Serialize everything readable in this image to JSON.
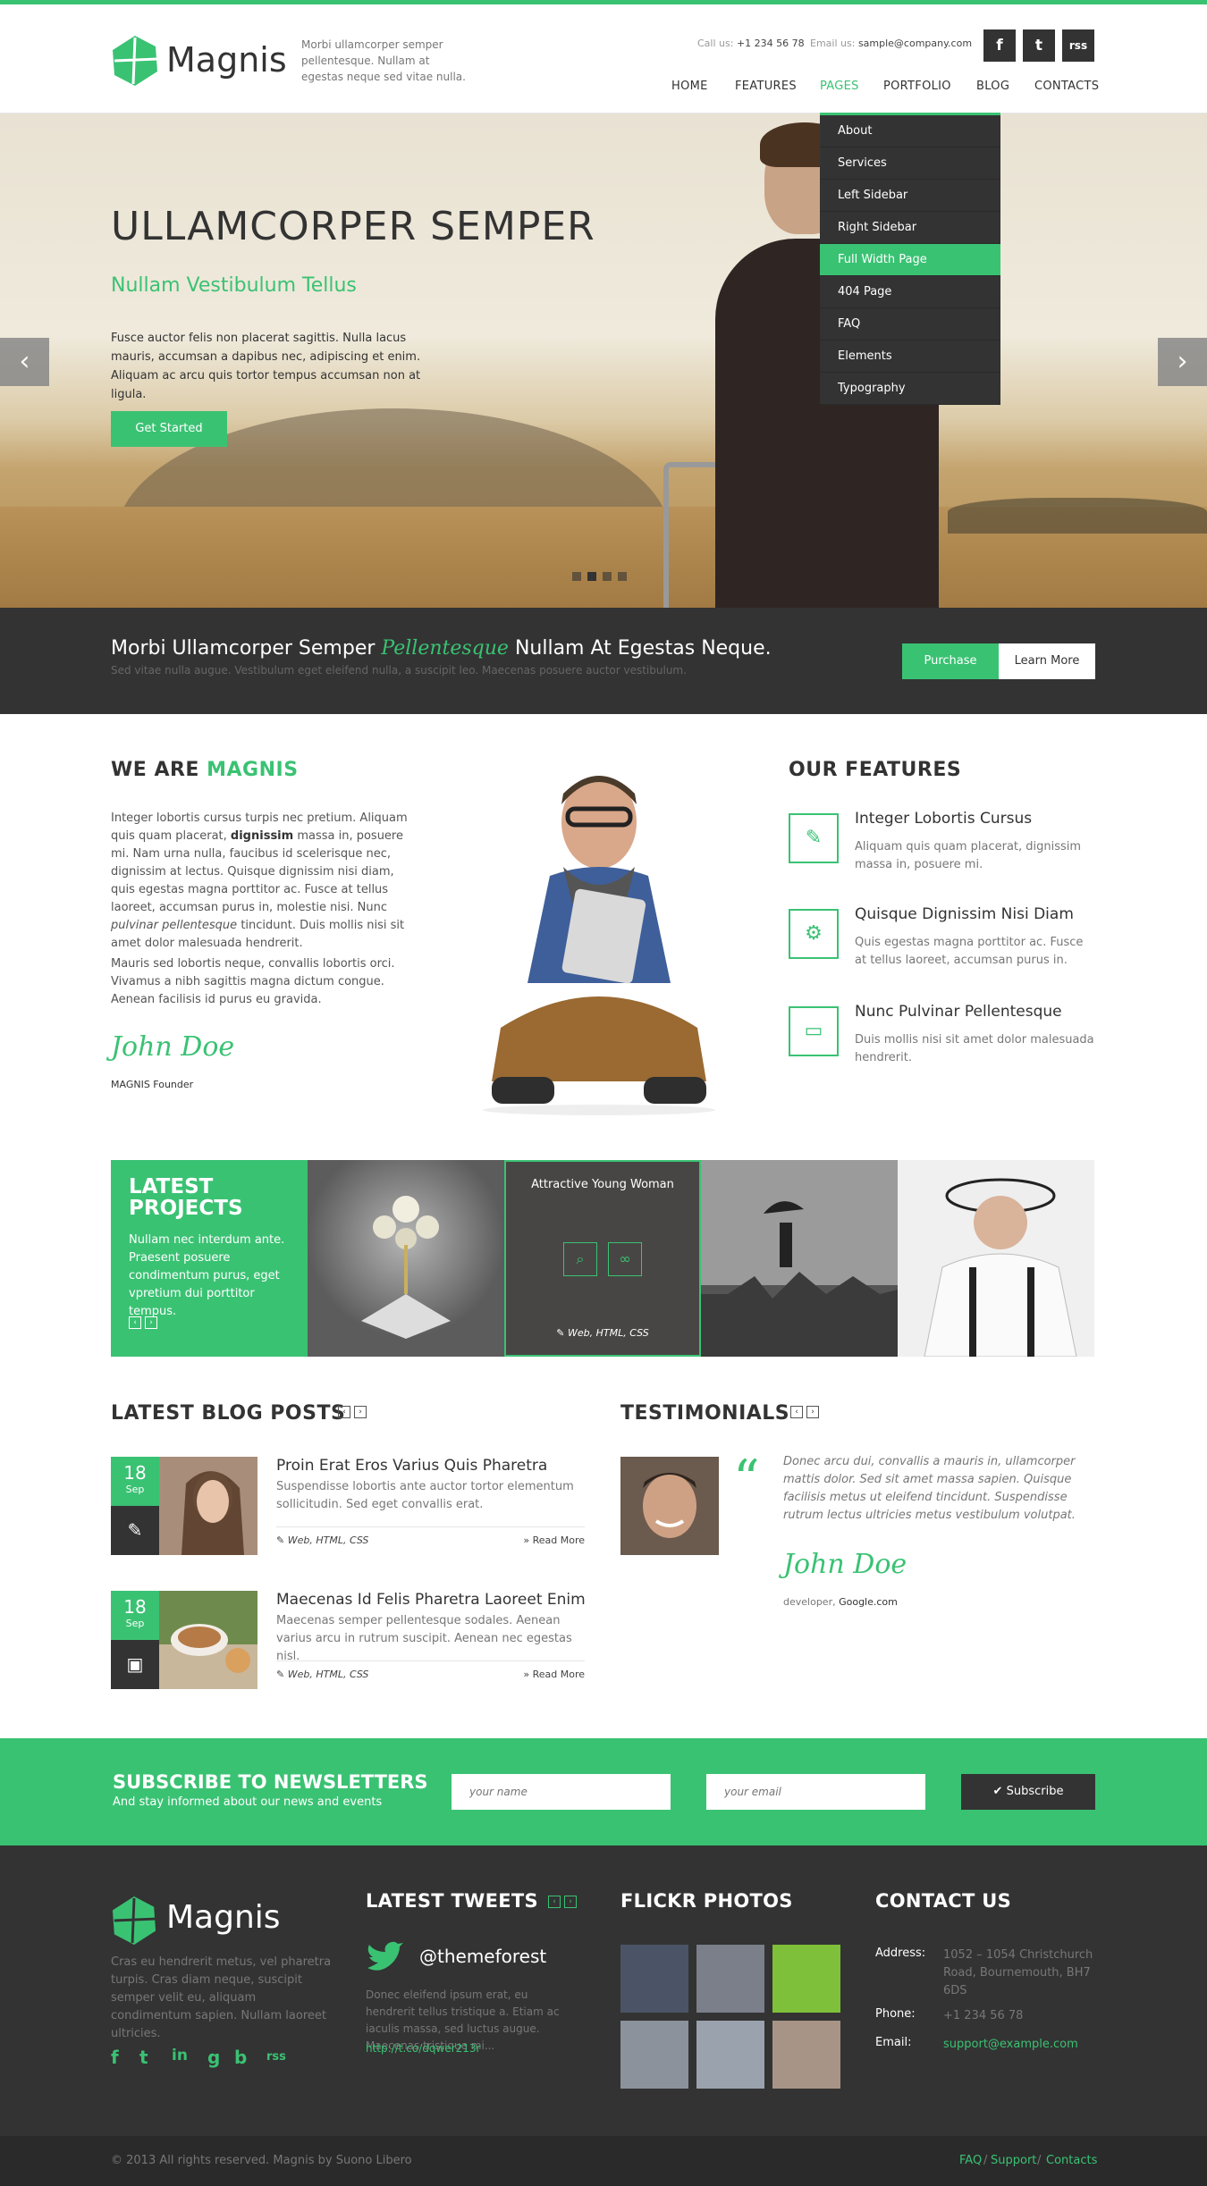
{
  "header": {
    "logo_text": "Magnis",
    "tagline": "Morbi ullamcorper semper pellentesque. Nullam at egestas neque sed vitae nulla.",
    "call_label": "Call us:",
    "call_value": "+1 234 56 78",
    "email_label": "Email us:",
    "email_value": "sample@company.com",
    "social": [
      "f",
      "t",
      "rss"
    ],
    "nav": [
      "HOME",
      "FEATURES",
      "PAGES",
      "PORTFOLIO",
      "BLOG",
      "CONTACTS"
    ],
    "active_nav": "PAGES"
  },
  "dropdown": {
    "items": [
      "About",
      "Services",
      "Left Sidebar",
      "Right Sidebar",
      "Full Width Page",
      "404 Page",
      "FAQ",
      "Elements",
      "Typography"
    ],
    "active": "Full Width Page"
  },
  "hero": {
    "title": "ULLAMCORPER SEMPER",
    "subtitle": "Nullam Vestibulum Tellus",
    "text": "Fusce auctor felis non placerat sagittis. Nulla lacus mauris, accumsan a dapibus nec, adipiscing et enim. Aliquam ac arcu quis tortor tempus accumsan non at ligula.",
    "button": "Get Started",
    "prev": "‹",
    "next": "›",
    "slide_count": 4,
    "active_slide": 2
  },
  "band": {
    "title_pre": "Morbi Ullamcorper Semper",
    "title_em": "Pellentesque",
    "title_post": "Nullam At Egestas Neque.",
    "sub": "Sed vitae nulla augue. Vestibulum eget eleifend nulla, a suscipit leo. Maecenas posuere auctor vestibulum.",
    "btn_purchase": "Purchase",
    "btn_learn": "Learn More"
  },
  "about": {
    "title_a": "WE ARE",
    "title_b": "MAGNIS",
    "p1_a": "Integer lobortis cursus turpis nec pretium. Aliquam quis quam placerat,",
    "p1_b": "dignissim",
    "p1_c": "massa in, posuere mi. Nam urna nulla, faucibus id scelerisque nec, dignissim at lectus. Quisque dignissim nisi diam, quis egestas magna porttitor ac. Fusce at tellus laoreet, accumsan purus in, molestie nisi. Nunc",
    "p1_d": "pulvinar pellentesque",
    "p1_e": "tincidunt. Duis mollis nisi sit amet dolor malesuada hendrerit.",
    "p2": "Mauris sed lobortis neque, convallis lobortis orci. Vivamus a nibh sagittis magna dictum congue. Aenean facilisis id purus eu gravida.",
    "signature": "John Doe",
    "role": "MAGNIS Founder"
  },
  "features": {
    "title": "OUR FEATURES",
    "items": [
      {
        "icon": "magic-wand-icon",
        "title": "Integer Lobortis Cursus",
        "text": "Aliquam quis quam placerat, dignissim massa in, posuere mi."
      },
      {
        "icon": "gear-icon",
        "title": "Quisque Dignissim Nisi Diam",
        "text": "Quis egestas magna porttitor ac. Fusce at tellus laoreet, accumsan purus in."
      },
      {
        "icon": "monitor-icon",
        "title": "Nunc Pulvinar Pellentesque",
        "text": "Duis mollis nisi sit amet dolor malesuada hendrerit."
      }
    ]
  },
  "projects": {
    "title_1": "LATEST",
    "title_2": "PROJECTS",
    "text": "Nullam nec interdum ante. Praesent posuere condimentum purus, eget vpretium dui porttitor tempus.",
    "prev": "‹",
    "next": "›",
    "hover_title": "Attractive Young Woman",
    "hover_tags": "Web, HTML, CSS"
  },
  "blog": {
    "title": "LATEST BLOG POSTS",
    "prev": "‹",
    "next": "›",
    "posts": [
      {
        "day": "18",
        "month": "Sep",
        "type_icon": "pencil-icon",
        "title": "Proin Erat Eros Varius Quis Pharetra",
        "text": "Suspendisse lobortis ante auctor tortor elementum sollicitudin. Sed eget convallis erat.",
        "tags": "Web, HTML, CSS",
        "more": "Read More"
      },
      {
        "day": "18",
        "month": "Sep",
        "type_icon": "image-icon",
        "title": "Maecenas Id Felis Pharetra Laoreet Enim",
        "text": "Maecenas semper pellentesque sodales. Aenean varius arcu in rutrum suscipit. Aenean nec egestas nisl.",
        "tags": "Web, HTML, CSS",
        "more": "Read More"
      }
    ]
  },
  "testimonials": {
    "title": "TESTIMONIALS",
    "prev": "‹",
    "next": "›",
    "text": "Donec arcu dui, convallis a mauris in, ullamcorper mattis dolor. Sed sit amet massa sapien. Quisque facilisis metus ut eleifend tincidunt. Suspendisse rutrum lectus ultricies metus vestibulum volutpat.",
    "signature": "John Doe",
    "role": "developer,",
    "company": "Google.com"
  },
  "newsletter": {
    "title": "SUBSCRIBE TO NEWSLETTERS",
    "sub": "And stay informed about our news and events",
    "name_placeholder": "your name",
    "email_placeholder": "your email",
    "button": "Subscribe"
  },
  "footer": {
    "logo_text": "Magnis",
    "about": "Cras eu hendrerit metus, vel pharetra turpis. Cras diam neque, suscipit semper velit eu, aliquam condimentum sapien. Nullam laoreet ultricies.",
    "social": [
      "f",
      "t",
      "in",
      "g",
      "b",
      "rss"
    ],
    "tweets_title": "LATEST TWEETS",
    "tweet_handle": "@themeforest",
    "tweet_text": "Donec eleifend ipsum erat, eu hendrerit tellus tristique a. Etiam ac iaculis massa, sed luctus augue. Maecenas tristique mi...",
    "tweet_link": "http://t.co/dqwer213r",
    "flickr_title": "FLICKR PHOTOS",
    "contact_title": "CONTACT US",
    "address_label": "Address:",
    "address": "1052 – 1054 Christchurch Road, Bournemouth, BH7 6DS",
    "phone_label": "Phone:",
    "phone": "+1 234 56 78",
    "email_label": "Email:",
    "email": "support@example.com"
  },
  "bottom": {
    "copyright": "© 2013 All rights reserved. Magnis by Suono Libero",
    "links": [
      "FAQ",
      "Support",
      "Contacts"
    ],
    "sep": "/"
  },
  "colors": {
    "accent": "#3ac273",
    "dark": "#333333"
  }
}
